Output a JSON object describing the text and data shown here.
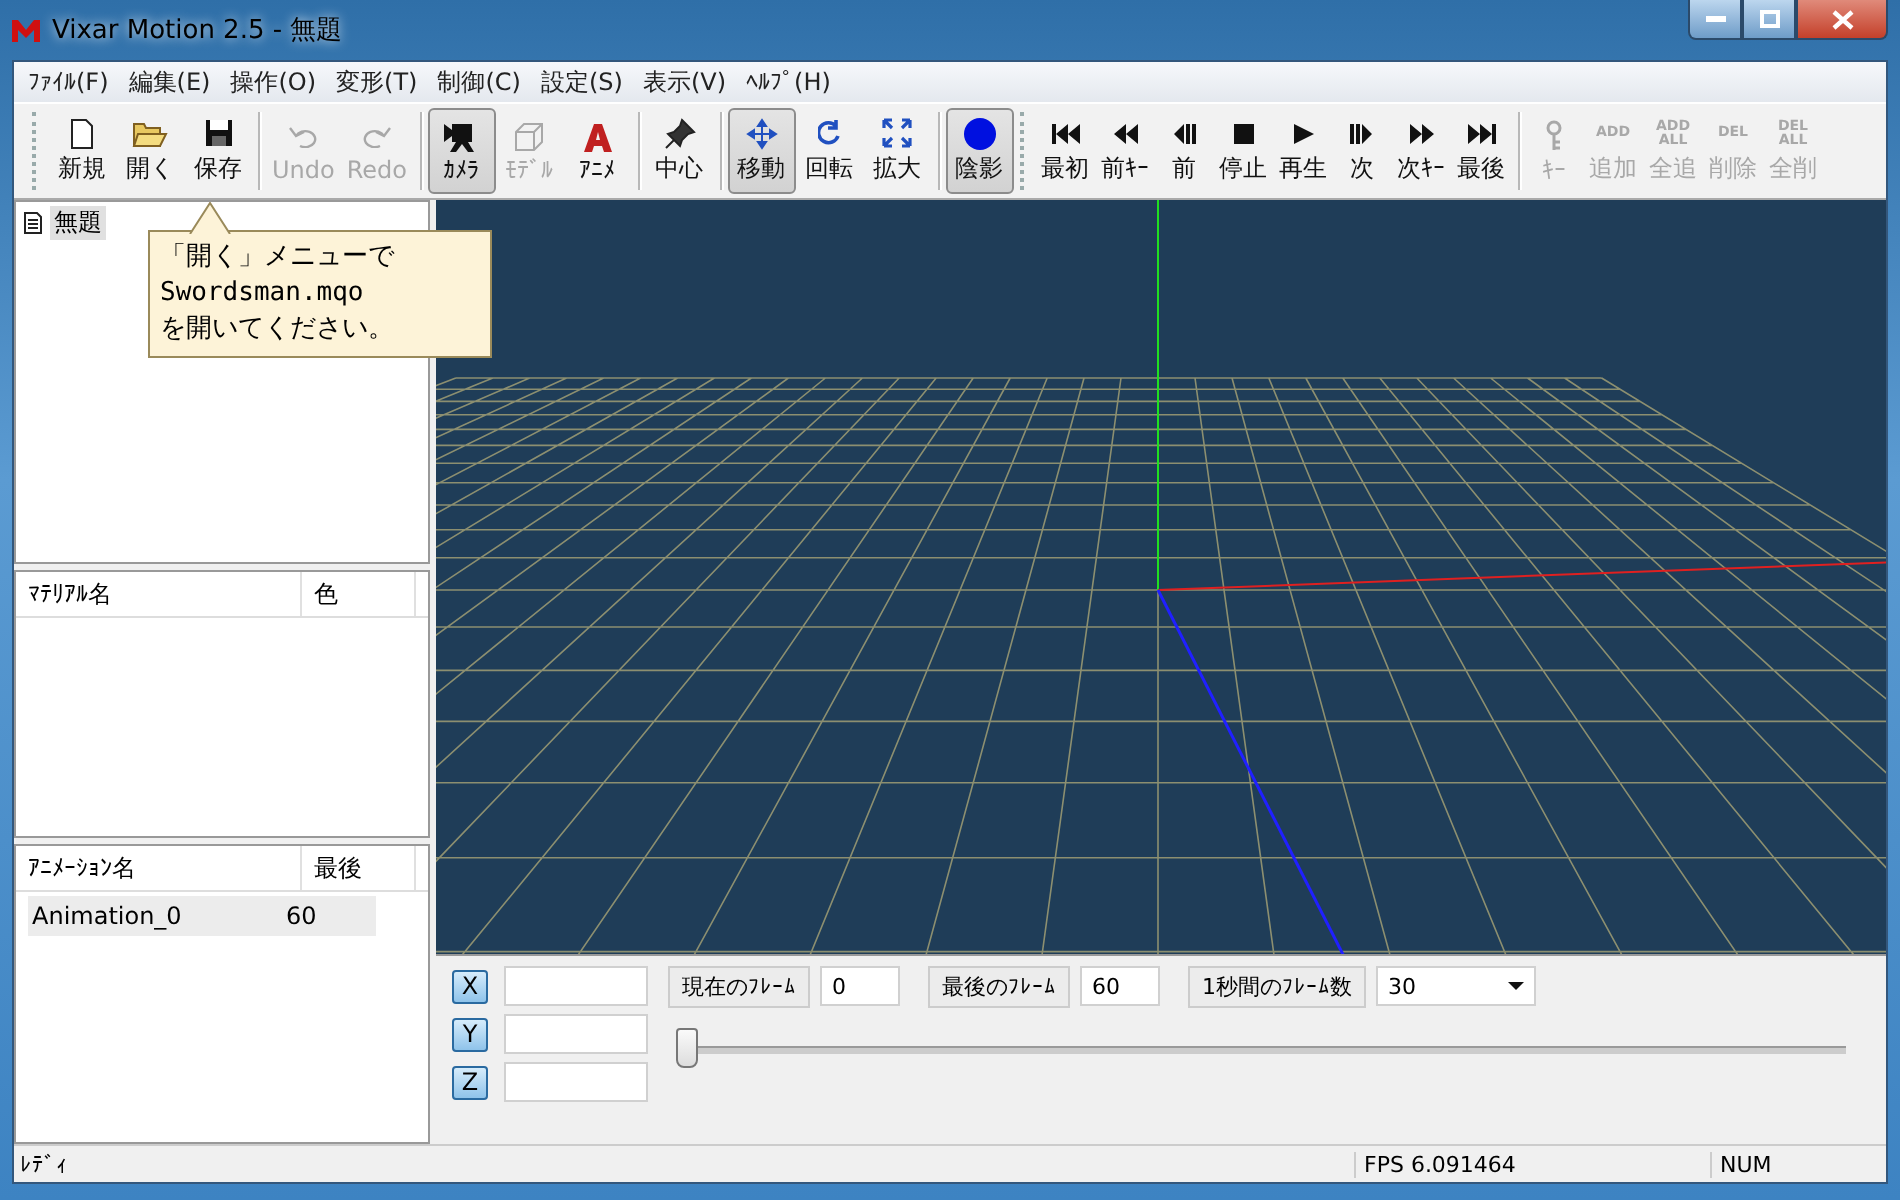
{
  "window": {
    "title": "Vixar Motion 2.5 - 無題"
  },
  "menu": [
    "ﾌｧｲﾙ(F)",
    "編集(E)",
    "操作(O)",
    "変形(T)",
    "制御(C)",
    "設定(S)",
    "表示(V)",
    "ﾍﾙﾌﾟ(H)"
  ],
  "toolbar_groups": [
    [
      {
        "label": "新規",
        "disabled": false,
        "pressed": false
      },
      {
        "label": "開く",
        "disabled": false,
        "pressed": false
      },
      {
        "label": "保存",
        "disabled": false,
        "pressed": false
      }
    ],
    [
      {
        "label": "Undo",
        "disabled": true,
        "pressed": false
      },
      {
        "label": "Redo",
        "disabled": true,
        "pressed": false
      }
    ],
    [
      {
        "label": "ｶﾒﾗ",
        "disabled": false,
        "pressed": true
      },
      {
        "label": "ﾓﾃﾞﾙ",
        "disabled": true,
        "pressed": false
      },
      {
        "label": "ｱﾆﾒ",
        "disabled": false,
        "pressed": false
      }
    ],
    [
      {
        "label": "中心",
        "disabled": false,
        "pressed": false
      }
    ],
    [
      {
        "label": "移動",
        "disabled": false,
        "pressed": true
      },
      {
        "label": "回転",
        "disabled": false,
        "pressed": false
      },
      {
        "label": "拡大",
        "disabled": false,
        "pressed": false
      }
    ],
    [
      {
        "label": "陰影",
        "disabled": false,
        "pressed": true
      }
    ],
    [
      {
        "label": "最初",
        "disabled": false,
        "pressed": false
      },
      {
        "label": "前ｷｰ",
        "disabled": false,
        "pressed": false
      },
      {
        "label": "前",
        "disabled": false,
        "pressed": false
      },
      {
        "label": "停止",
        "disabled": false,
        "pressed": false
      },
      {
        "label": "再生",
        "disabled": false,
        "pressed": false
      },
      {
        "label": "次",
        "disabled": false,
        "pressed": false
      },
      {
        "label": "次ｷｰ",
        "disabled": false,
        "pressed": false
      },
      {
        "label": "最後",
        "disabled": false,
        "pressed": false
      }
    ],
    [
      {
        "label": "ｷｰ",
        "disabled": true,
        "pressed": false
      },
      {
        "label": "追加",
        "disabled": true,
        "pressed": false,
        "icon_text": [
          "ADD"
        ]
      },
      {
        "label": "全追",
        "disabled": true,
        "pressed": false,
        "icon_text": [
          "ADD",
          "ALL"
        ]
      },
      {
        "label": "削除",
        "disabled": true,
        "pressed": false,
        "icon_text": [
          "DEL"
        ]
      },
      {
        "label": "全削",
        "disabled": true,
        "pressed": false,
        "icon_text": [
          "DEL",
          "ALL"
        ]
      }
    ]
  ],
  "tree": [
    {
      "label": "無題",
      "selected": true
    }
  ],
  "callout": {
    "lines": [
      "「開く」メニューで",
      "Swordsman.mqo",
      "を開いてください。"
    ]
  },
  "material_table": {
    "columns": [
      "ﾏﾃﾘｱﾙ名",
      "色"
    ]
  },
  "animation_table": {
    "columns": [
      "ｱﾆﾒｰｼｮﾝ名",
      "最後"
    ],
    "rows": [
      {
        "cells": [
          "Animation_0",
          "60"
        ],
        "selected": true
      }
    ]
  },
  "axis_buttons": [
    "X",
    "Y",
    "Z"
  ],
  "frame_fields": [
    {
      "kind": "input",
      "label": "現在のﾌﾚｰﾑ",
      "value": "0"
    },
    {
      "kind": "input",
      "label": "最後のﾌﾚｰﾑ",
      "value": "60"
    },
    {
      "kind": "select",
      "label": "1秒間のﾌﾚｰﾑ数",
      "value": "30"
    }
  ],
  "timeline": {
    "level": 0
  },
  "status_bar": {
    "message": "ﾚﾃﾞｨ",
    "fps": "FPS 6.091464",
    "num": "NUM"
  }
}
